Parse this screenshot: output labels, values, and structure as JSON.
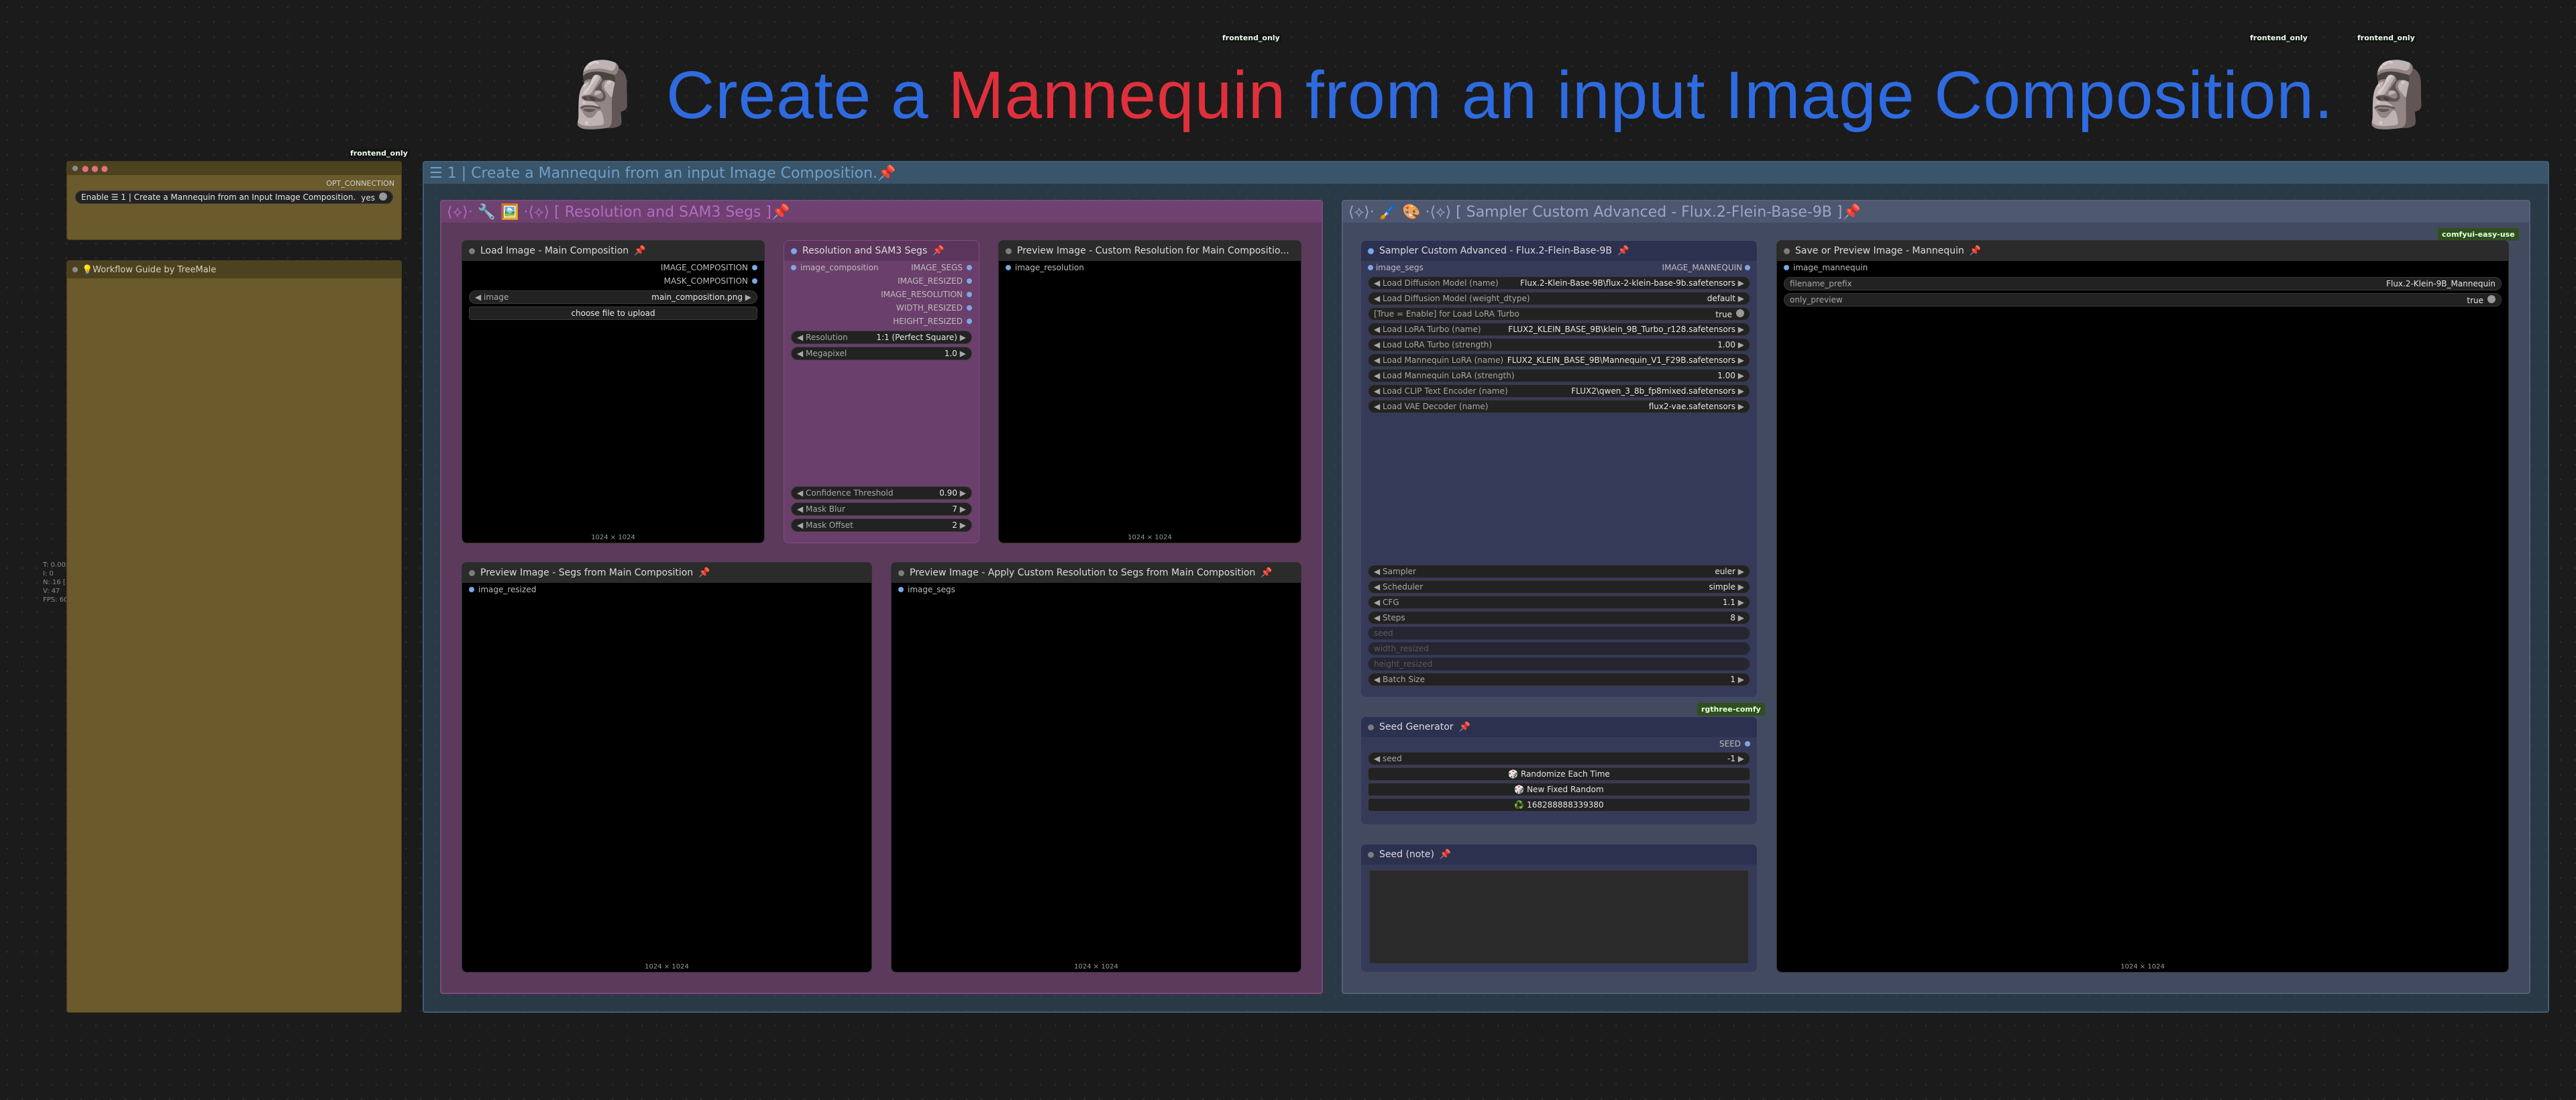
{
  "tags": {
    "frontend_only_1": "frontend_only",
    "frontend_only_2": "frontend_only",
    "frontend_only_3": "frontend_only",
    "frontend_only_4": "frontend_only",
    "comfyui_easy_use": "comfyui-easy-use",
    "rgthree_comfy": "rgthree-comfy"
  },
  "banner": {
    "moai": "🗿",
    "part1": "Create a ",
    "part2": "Mannequin",
    "part3": " from an input Image Composition."
  },
  "side_stats": [
    "T: 0.00s",
    "I: 0",
    "N: 16 [16]",
    "V: 47",
    "FPS: 60.00"
  ],
  "fast_groups": {
    "output_label": "OPT_CONNECTION",
    "toggle_label": "Enable ☰ 1 | Create a Mannequin from an Input Image Composition.",
    "toggle_value": "yes"
  },
  "guide": {
    "title": "💡Workflow Guide by TreeMale"
  },
  "main_group": {
    "title": "☰ 1 | Create a Mannequin from an input Image Composition.📌"
  },
  "resolution_group": {
    "title": "⟨⟡⟩· 🔧 🖼️ ·⟨⟡⟩ [ Resolution and SAM3 Segs ]📌"
  },
  "sampler_group": {
    "title": "⟨⟡⟩· 🖌️ 🎨 ·⟨⟡⟩ [ Sampler Custom Advanced - Flux.2-Flein-Base-9B ]📌"
  },
  "load_image": {
    "title": "Load Image - Main Composition",
    "out1": "IMAGE_COMPOSITION",
    "out2": "MASK_COMPOSITION",
    "image_label": "image",
    "image_value": "main_composition.png",
    "upload": "choose file to upload",
    "dims": "1024 × 1024"
  },
  "res_sam": {
    "title": "Resolution and SAM3 Segs",
    "input": "image_composition",
    "outs": [
      "IMAGE_SEGS",
      "IMAGE_RESIZED",
      "IMAGE_RESOLUTION",
      "WIDTH_RESIZED",
      "HEIGHT_RESIZED"
    ],
    "resolution_label": "Resolution",
    "resolution_value": "1:1 (Perfect Square)",
    "megapixel_label": "Megapixel",
    "megapixel_value": "1.0",
    "conf_label": "Confidence Threshold",
    "conf_value": "0.90",
    "blur_label": "Mask Blur",
    "blur_value": "7",
    "offset_label": "Mask Offset",
    "offset_value": "2"
  },
  "preview_res": {
    "title": "Preview Image - Custom Resolution for Main Compositio...",
    "input": "image_resolution",
    "dims": "1024 × 1024"
  },
  "preview_segs": {
    "title": "Preview Image - Segs from Main Composition",
    "input": "image_resized",
    "dims": "1024 × 1024"
  },
  "preview_apply": {
    "title": "Preview Image - Apply Custom Resolution to Segs from Main Composition",
    "input": "image_segs",
    "dims": "1024 × 1024"
  },
  "sampler": {
    "title": "Sampler Custom Advanced - Flux.2-Flein-Base-9B",
    "input": "image_segs",
    "output": "IMAGE_MANNEQUIN",
    "widgets": [
      {
        "label": "Load Diffusion Model (name)",
        "value": "Flux.2-Klein-Base-9B\\flux-2-klein-base-9b.safetensors"
      },
      {
        "label": "Load Diffusion Model (weight_dtype)",
        "value": "default"
      },
      {
        "label": "[True = Enable] for Load LoRA Turbo",
        "value": "true"
      },
      {
        "label": "Load LoRA Turbo (name)",
        "value": "FLUX2_KLEIN_BASE_9B\\klein_9B_Turbo_r128.safetensors"
      },
      {
        "label": "Load LoRA Turbo (strength)",
        "value": "1.00"
      },
      {
        "label": "Load Mannequin LoRA (name)",
        "value": "FLUX2_KLEIN_BASE_9B\\Mannequin_V1_F29B.safetensors"
      },
      {
        "label": "Load Mannequin LoRA (strength)",
        "value": "1.00"
      },
      {
        "label": "Load CLIP Text Encoder (name)",
        "value": "FLUX2\\qwen_3_8b_fp8mixed.safetensors"
      },
      {
        "label": "Load VAE Decoder (name)",
        "value": "flux2-vae.safetensors"
      }
    ],
    "lower": [
      {
        "label": "Sampler",
        "value": "euler"
      },
      {
        "label": "Scheduler",
        "value": "simple"
      },
      {
        "label": "CFG",
        "value": "1.1"
      },
      {
        "label": "Steps",
        "value": "8"
      }
    ],
    "dim_widgets": [
      "seed",
      "width_resized",
      "height_resized"
    ],
    "batch_label": "Batch Size",
    "batch_value": "1"
  },
  "seed_gen": {
    "title": "Seed Generator",
    "output": "SEED",
    "seed_label": "seed",
    "seed_value": "-1",
    "btn1": "🎲 Randomize Each Time",
    "btn2": "🎲 New Fixed Random",
    "btn3": "♻️ 168288888339380"
  },
  "seed_note": {
    "title": "Seed (note)"
  },
  "save_preview": {
    "title": "Save or Preview Image - Mannequin",
    "input": "image_mannequin",
    "prefix_label": "filename_prefix",
    "prefix_value": "Flux.2-Klein-9B_Mannequin",
    "only_label": "only_preview",
    "only_value": "true",
    "dims": "1024 × 1024"
  }
}
